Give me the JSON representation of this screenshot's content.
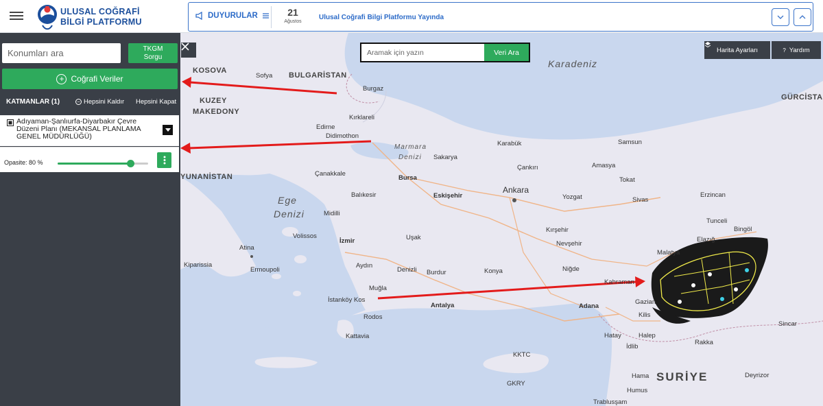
{
  "header": {
    "logo_line1": "ULUSAL COĞRAFİ",
    "logo_line2": "BİLGİ PLATFORMU",
    "announcements_label": "DUYURULAR",
    "date_day": "21",
    "date_month": "Ağustos",
    "announcement_text": "Ulusal Coğrafi Bilgi Platformu Yayında"
  },
  "sidebar": {
    "search_placeholder": "Konumları ara",
    "tkgm_line1": "TKGM",
    "tkgm_line2": "Sorgu",
    "cografi_label": "Coğrafi Veriler",
    "layers_title": "KATMANLAR (1)",
    "remove_all": "Hepsini Kaldır",
    "close_all": "Hepsini Kapat",
    "layer_name": "Adıyaman-Şanlıurfa-Diyarbakır Çevre Düzeni Planı (MEKANSAL PLANLAMA GENEL MÜDÜRLÜĞÜ)",
    "opacity_label": "Opasite: 80 %",
    "opacity_value": 0.8
  },
  "map": {
    "search_placeholder": "Aramak için yazın",
    "search_button": "Veri Ara",
    "settings_button": "Harita Ayarları",
    "help_button": "Yardım",
    "labels": {
      "kosova": "KOSOVA",
      "sofya": "Sofya",
      "bulgaristan": "BULGARİSTAN",
      "burgaz": "Burgaz",
      "karadeniz": "Karadeniz",
      "gurcistan": "GÜRCİSTA",
      "kuzey": "KUZEY",
      "makedonya": "MAKEDONY",
      "kirklareli": "Kırklareli",
      "edirne": "Edirne",
      "didimothon": "Didimothon",
      "marmara": "Marmara",
      "denizi": "Denizi",
      "karabuk": "Karabük",
      "samsun": "Samsun",
      "sakarya": "Sakarya",
      "cankiri": "Çankırı",
      "amasya": "Amasya",
      "yunanistan": "YUNANİSTAN",
      "canakkale": "Çanakkale",
      "bursa": "Bursa",
      "tokat": "Tokat",
      "erzincan": "Erzincan",
      "ege": "Ege",
      "ege_denizi": "Denizi",
      "balikesir": "Balıkesir",
      "eskisehir": "Eskişehir",
      "ankara": "Ankara",
      "yozgat": "Yozgat",
      "sivas": "Sivas",
      "midilli": "Midilli",
      "tunceli": "Tunceli",
      "bingol": "Bingöl",
      "volissos": "Volissos",
      "izmir": "İzmir",
      "usak": "Uşak",
      "kirsehir": "Kırşehir",
      "elazig": "Elazığ",
      "atina": "Atina",
      "nevsehir": "Nevşehir",
      "malatya": "Malatya",
      "kiparissia": "Kiparissia",
      "aydin": "Aydın",
      "denizli": "Denizli",
      "burdur": "Burdur",
      "konya": "Konya",
      "nigde": "Niğde",
      "ermoupoli": "Ermoupoli",
      "mugla": "Muğla",
      "kahraman": "Kahraman",
      "istankoy": "İstanköy Kos",
      "antalya": "Antalya",
      "adana": "Adana",
      "gazian": "Gazian",
      "kilis": "Kilis",
      "rodos": "Rodos",
      "sincar": "Sincar",
      "kattavia": "Kattavia",
      "hatay": "Hatay",
      "halep": "Halep",
      "rakka": "Rakka",
      "idlib": "İdlib",
      "kktc": "KKTC",
      "gkry": "GKRY",
      "suriye": "SURİYE",
      "hama": "Hama",
      "deyrizor": "Deyrizor",
      "humus": "Humus",
      "trablussam": "Trablusşam"
    }
  },
  "colors": {
    "accent": "#2eaa5c",
    "brand": "#1c4f9c",
    "sidebar": "#3a3f47",
    "announcement": "#2c6bc8",
    "arrow": "#e31b1b"
  }
}
